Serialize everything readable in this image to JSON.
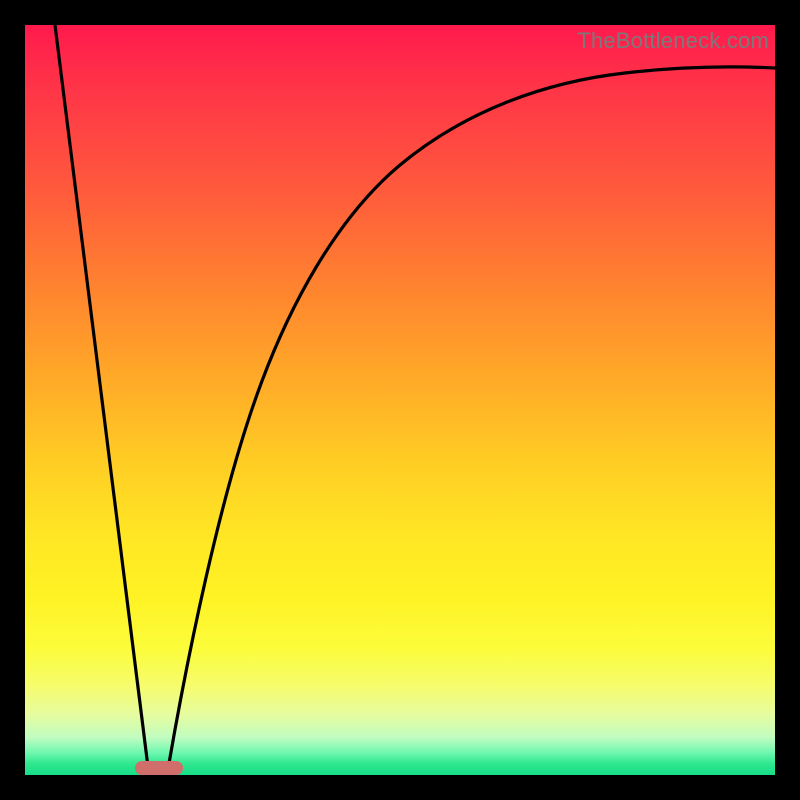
{
  "attribution": "TheBottleneck.com",
  "colors": {
    "frame": "#000000",
    "gradient_stops": [
      "#ff1a4d",
      "#ff5a3c",
      "#ffa628",
      "#ffe624",
      "#fcfc3a",
      "#18dd88"
    ],
    "curve": "#000000",
    "marker": "#cf6e6a"
  },
  "chart_data": {
    "type": "line",
    "title": "",
    "xlabel": "",
    "ylabel": "",
    "xlim": [
      0,
      100
    ],
    "ylim": [
      0,
      100
    ],
    "series": [
      {
        "name": "left-descending-line",
        "x": [
          4,
          16.5
        ],
        "values": [
          100,
          0
        ]
      },
      {
        "name": "right-asymptotic-curve",
        "x": [
          19,
          22,
          26,
          30,
          35,
          40,
          45,
          50,
          55,
          60,
          65,
          70,
          75,
          80,
          85,
          90,
          95,
          100
        ],
        "values": [
          0,
          18,
          36,
          48,
          58,
          66,
          72,
          77,
          81,
          84,
          86.5,
          88.5,
          90,
          91.2,
          92.2,
          93,
          93.7,
          94.3
        ]
      }
    ],
    "marker": {
      "x_center": 17.8,
      "y": 0,
      "shape": "rounded-bar"
    }
  }
}
